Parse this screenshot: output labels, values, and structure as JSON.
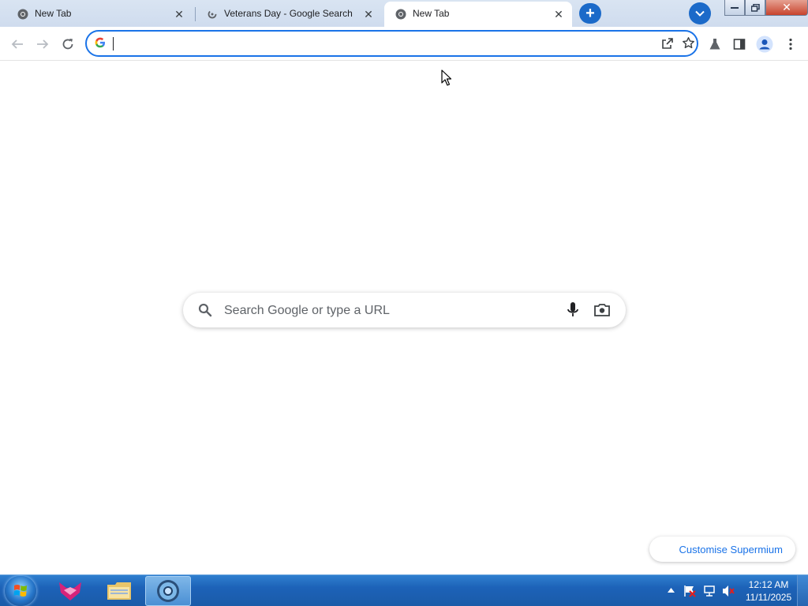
{
  "tabs": [
    {
      "title": "New Tab",
      "state": "inactive",
      "favicon": "chrome-icon"
    },
    {
      "title": "Veterans Day - Google Search",
      "state": "inactive",
      "favicon": "loading-icon"
    },
    {
      "title": "New Tab",
      "state": "active",
      "favicon": "chrome-icon"
    }
  ],
  "tab_close_symbol": "✕",
  "new_tab_symbol": "+",
  "window_controls": {
    "close_symbol": "✕"
  },
  "omnibox": {
    "value": "",
    "placeholder": "",
    "provider_icon": "G"
  },
  "search": {
    "placeholder": "Search Google or type a URL"
  },
  "customise_button": "Customise Supermium",
  "taskbar": {
    "apps": [
      "start-orb",
      "foxit-app",
      "file-explorer",
      "supermium-browser"
    ],
    "clock_time": "12:12 AM",
    "clock_date": "11/11/2025"
  },
  "colors": {
    "accent": "#1a73e8",
    "tabstrip": "#d3dff0",
    "taskbar": "#1d62b8"
  }
}
